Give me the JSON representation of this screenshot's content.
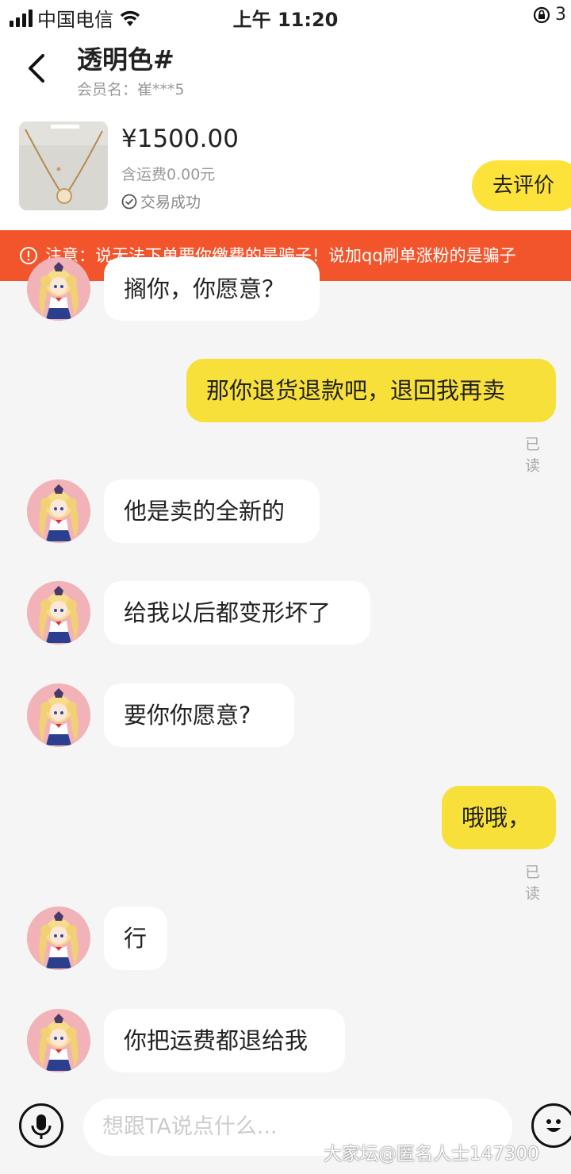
{
  "status_bar": {
    "carrier": "中国电信",
    "time": "上午 11:20",
    "battery": "3"
  },
  "header": {
    "title": "透明色#",
    "subtitle": "会员名：崔***5"
  },
  "product": {
    "price": "¥1500.00",
    "shipping": "含运费0.00元",
    "status": "交易成功",
    "rate_button": "去评价"
  },
  "notice": {
    "text": "注意：说无法下单要你缴费的是骗子！说加qq刷单涨粉的是骗子"
  },
  "messages": [
    {
      "side": "in",
      "text": "搁你，你愿意？"
    },
    {
      "side": "out",
      "text": "那你退货退款吧，退回我再卖",
      "read": "已读"
    },
    {
      "side": "in",
      "text": "他是卖的全新的"
    },
    {
      "side": "in",
      "text": "给我以后都变形坏了"
    },
    {
      "side": "in",
      "text": "要你你愿意?"
    },
    {
      "side": "out",
      "text": "哦哦，",
      "read": "已读"
    },
    {
      "side": "in",
      "text": "行"
    },
    {
      "side": "in",
      "text": "你把运费都退给我"
    }
  ],
  "input": {
    "placeholder": "想跟TA说点什么..."
  },
  "watermark": "大家坛@匿名人士147300",
  "colors": {
    "accent_yellow": "#fde23a",
    "notice_red": "#f2552c",
    "background": "#f5f5f5"
  },
  "icons": {
    "back": "back-arrow-icon",
    "mic": "microphone-icon",
    "emoji": "emoji-icon",
    "check": "check-circle-icon",
    "alert": "alert-circle-icon"
  }
}
